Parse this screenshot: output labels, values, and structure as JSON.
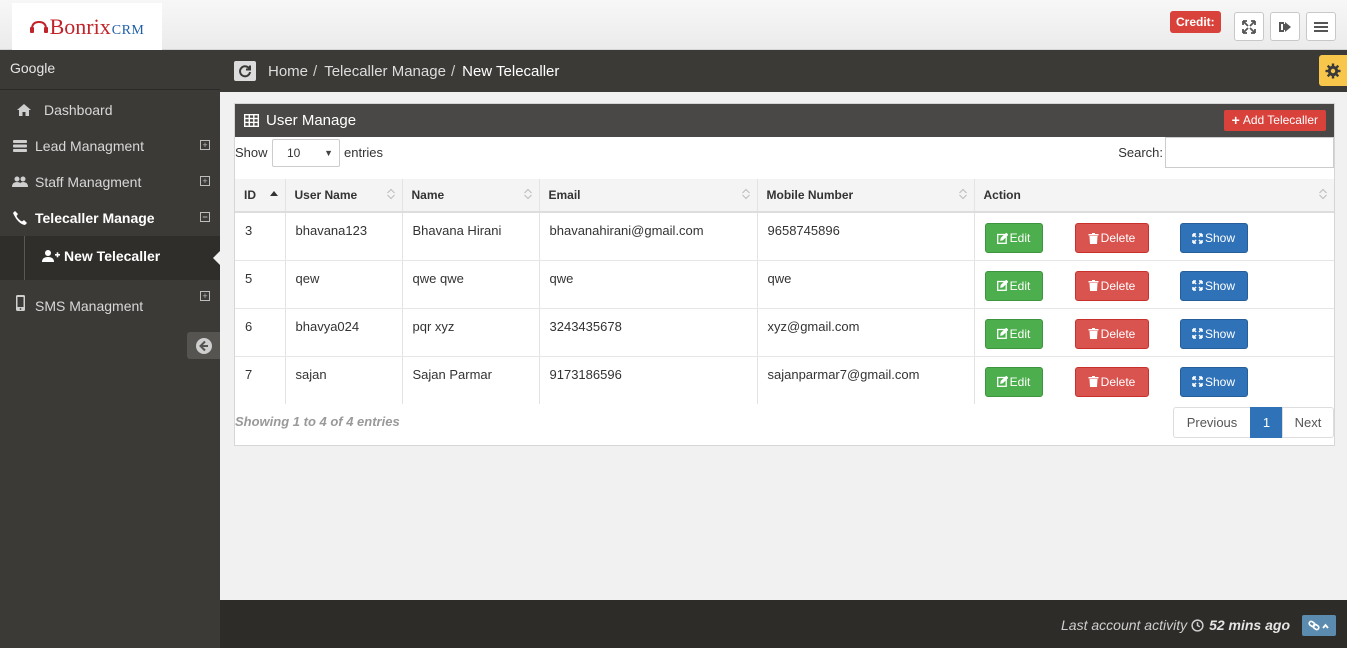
{
  "header": {
    "brand": "Bonrix",
    "brand_suffix": "CRM",
    "credit_label": "Credit:"
  },
  "sidebar": {
    "account": "Google",
    "items": [
      {
        "label": "Dashboard"
      },
      {
        "label": "Lead Managment"
      },
      {
        "label": "Staff Managment"
      },
      {
        "label": "Telecaller Manage"
      },
      {
        "label": "SMS Managment"
      }
    ],
    "sub_item": "New Telecaller"
  },
  "breadcrumb": {
    "home": "Home",
    "parent": "Telecaller Manage",
    "current": "New Telecaller",
    "separator": "/"
  },
  "panel": {
    "title": "User Manage",
    "add_button": "Add Telecaller",
    "show_label": "Show",
    "page_length": "10",
    "entries_label": "entries",
    "search_label": "Search:",
    "search_value": ""
  },
  "table": {
    "headers": [
      "ID",
      "User Name",
      "Name",
      "Email",
      "Mobile Number",
      "Action"
    ],
    "rows": [
      {
        "id": "3",
        "username": "bhavana123",
        "name": "Bhavana Hirani",
        "email": "bhavanahirani@gmail.com",
        "mobile": "9658745896"
      },
      {
        "id": "5",
        "username": "qew",
        "name": "qwe qwe",
        "email": "qwe",
        "mobile": "qwe"
      },
      {
        "id": "6",
        "username": "bhavya024",
        "name": "pqr xyz",
        "email": "3243435678",
        "mobile": "xyz@gmail.com"
      },
      {
        "id": "7",
        "username": "sajan",
        "name": "Sajan Parmar",
        "email": "9173186596",
        "mobile": "sajanparmar7@gmail.com"
      }
    ],
    "edit_label": "Edit",
    "delete_label": "Delete",
    "show_label": "Show"
  },
  "pagination": {
    "info": "Showing 1 to 4 of 4 entries",
    "previous": "Previous",
    "page": "1",
    "next": "Next"
  },
  "footer": {
    "activity_label": "Last account activity",
    "activity_value": "52 mins ago"
  },
  "colors": {
    "sidebar_bg": "#3c3a37",
    "danger": "#d9413b",
    "success": "#4cae4c",
    "primary": "#2f72b8",
    "warning": "#f7c64b"
  },
  "icons": [
    "home-icon",
    "server-icon",
    "users-icon",
    "phone-icon",
    "user-plus-icon",
    "mobile-icon",
    "refresh-icon",
    "gear-icon",
    "table-icon",
    "fullscreen-icon",
    "logout-icon",
    "menu-icon",
    "clock-icon",
    "link-icon"
  ]
}
